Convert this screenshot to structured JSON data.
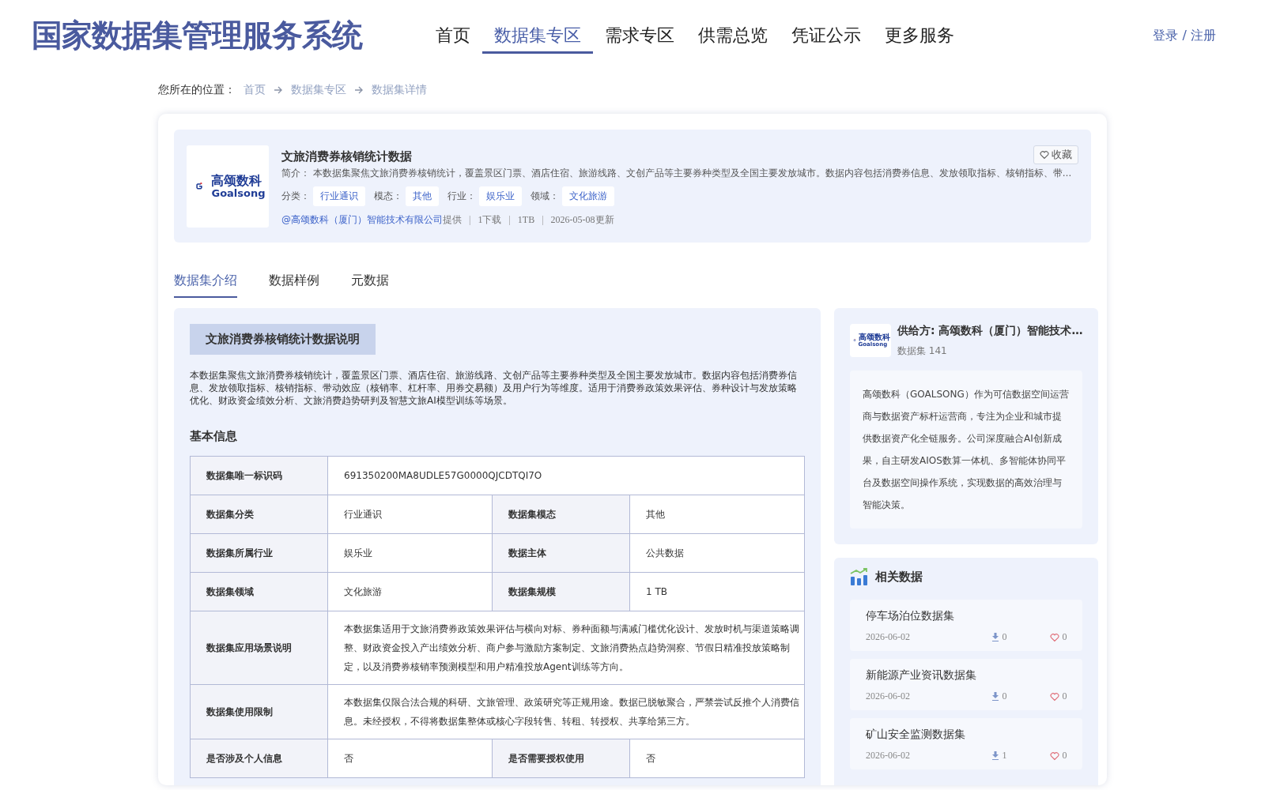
{
  "site": {
    "title": "国家数据集管理服务系统",
    "login": "登录 / 注册"
  },
  "nav": [
    {
      "label": "首页",
      "selected": false
    },
    {
      "label": "数据集专区",
      "selected": true
    },
    {
      "label": "需求专区",
      "selected": false
    },
    {
      "label": "供需总览",
      "selected": false
    },
    {
      "label": "凭证公示",
      "selected": false
    },
    {
      "label": "更多服务",
      "selected": false
    }
  ],
  "breadcrumb": {
    "label": "您所在的位置：",
    "items": [
      "首页",
      "数据集专区",
      "数据集详情"
    ]
  },
  "dataset": {
    "logo": {
      "name": "高颂数科",
      "latin": "Goalsong"
    },
    "title": "文旅消费券核销统计数据",
    "favorite": "收藏",
    "summary_label": "简介：",
    "summary": "本数据集聚焦文旅消费券核销统计，覆盖景区门票、酒店住宿、旅游线路、文创产品等主要券种类型及全国主要发放城市。数据内容包括消费券信息、发放领取指标、核销指标、带…",
    "tags": [
      {
        "label": "分类：",
        "value": "行业通识"
      },
      {
        "label": "模态：",
        "value": "其他"
      },
      {
        "label": "行业：",
        "value": "娱乐业"
      },
      {
        "label": "领域：",
        "value": "文化旅游"
      }
    ],
    "provider_link": "@高颂数科（厦门）智能技术有限公司",
    "provided": "提供",
    "separator": "|",
    "meta": [
      "1下载",
      "1TB",
      "2026-05-08更新"
    ]
  },
  "tabs": [
    {
      "label": "数据集介绍",
      "selected": true
    },
    {
      "label": "数据样例",
      "selected": false
    },
    {
      "label": "元数据",
      "selected": false
    }
  ],
  "intro": {
    "heading": "文旅消费券核销统计数据说明",
    "text": "本数据集聚焦文旅消费券核销统计，覆盖景区门票、酒店住宿、旅游线路、文创产品等主要券种类型及全国主要发放城市。数据内容包括消费券信息、发放领取指标、核销指标、带动效应（核销率、杠杆率、用券交易额）及用户行为等维度。适用于消费券政策效果评估、券种设计与发放策略优化、财政资金绩效分析、文旅消费趋势研判及智慧文旅AI模型训练等场景。",
    "basic_heading": "基本信息",
    "rows": [
      {
        "cells": [
          "数据集唯一标识码",
          "691350200MA8UDLE57G0000QJCDTQI7O"
        ]
      },
      {
        "cells": [
          "数据集分类",
          "行业通识",
          "数据集模态",
          "其他"
        ]
      },
      {
        "cells": [
          "数据集所属行业",
          "娱乐业",
          "数据主体",
          "公共数据"
        ]
      },
      {
        "cells": [
          "数据集领域",
          "文化旅游",
          "数据集规模",
          "1 TB"
        ]
      },
      {
        "cells": [
          "数据集应用场景说明",
          "本数据集适用于文旅消费券政策效果评估与横向对标、券种面额与满减门槛优化设计、发放时机与渠道策略调整、财政资金投入产出绩效分析、商户参与激励方案制定、文旅消费热点趋势洞察、节假日精准投放策略制定，以及消费券核销率预测模型和用户精准投放Agent训练等方向。"
        ]
      },
      {
        "cells": [
          "数据集使用限制",
          "本数据集仅限合法合规的科研、文旅管理、政策研究等正规用途。数据已脱敏聚合，严禁尝试反推个人消费信息。未经授权，不得将数据集整体或核心字段转售、转租、转授权、共享给第三方。"
        ]
      },
      {
        "cells": [
          "是否涉及个人信息",
          "否",
          "是否需要授权使用",
          "否"
        ]
      }
    ]
  },
  "provider": {
    "logo": {
      "name": "高颂数科",
      "latin": "Goalsong"
    },
    "name": "供给方: 高颂数科（厦门）智能技术…",
    "count": "数据集 141",
    "description": "高颂数科（GOALSONG）作为可信数据空间运营商与数据资产标杆运营商，专注为企业和城市提供数据资产化全链服务。公司深度融合AI创新成果，自主研发AIOS数算一体机、多智能体协同平台及数据空间操作系统，实现数据的高效治理与智能决策。"
  },
  "related": {
    "heading": "相关数据",
    "items": [
      {
        "title": "停车场泊位数据集",
        "date": "2026-06-02",
        "downloads": "0",
        "likes": "0"
      },
      {
        "title": "新能源产业资讯数据集",
        "date": "2026-06-02",
        "downloads": "0",
        "likes": "0"
      },
      {
        "title": "矿山安全监测数据集",
        "date": "2026-06-02",
        "downloads": "1",
        "likes": "0"
      }
    ]
  }
}
